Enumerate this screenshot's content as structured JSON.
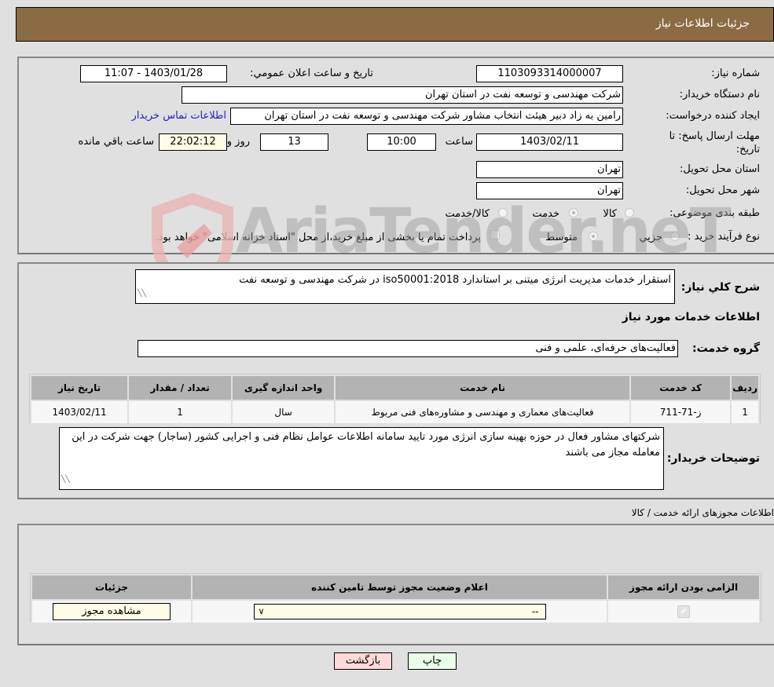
{
  "header": {
    "title": "جزئیات اطلاعات نیاز"
  },
  "details": {
    "need_number_label": "شماره نیاز:",
    "need_number": "1103093314000007",
    "announce_label": "تاریخ و ساعت اعلان عمومي:",
    "announce_value": "1403/01/28 - 11:07",
    "buyer_org_label": "نام دستگاه خریدار:",
    "buyer_org": "شرکت مهندسی و توسعه نفت در استان تهران",
    "requester_label": "ایجاد کننده درخواست:",
    "requester": "رامین به زاد دبیر هیئت انتخاب مشاور شرکت مهندسی و توسعه نفت در استان تهران",
    "buyer_contact_link": "اطلاعات تماس خریدار",
    "deadline_label": "مهلت ارسال پاسخ: تا تاریخ:",
    "deadline_date": "1403/02/11",
    "time_label": "ساعت",
    "deadline_time": "10:00",
    "days_value": "13",
    "days_label": "روز و",
    "remaining_time": "22:02:12",
    "remaining_label": "ساعت باقي مانده",
    "province_label": "استان محل تحویل:",
    "province": "تهران",
    "city_label": "شهر محل تحویل:",
    "city": "تهران",
    "category_label": "طبقه بندی موضوعی:",
    "category_options": [
      {
        "label": "کالا",
        "checked": false
      },
      {
        "label": "خدمت",
        "checked": true
      },
      {
        "label": "کالا/خدمت",
        "checked": false
      }
    ],
    "process_label": "نوع فرآیند خرید :",
    "process_options": [
      {
        "label": "جزيي",
        "checked": false
      },
      {
        "label": "متوسط",
        "checked": true
      }
    ],
    "treasury_note": "پرداخت تمام یا بخشی از مبلغ خرید،از محل \"اسناد خزانه اسلامی\" خواهد بود."
  },
  "need": {
    "summary_label": "شرح کلي نیاز:",
    "summary": "استقرار خدمات مدیریت انرژی میتنی بر استاندارد iso50001:2018 در شرکت مهندسی و توسعه نفت",
    "services_heading": "اطلاعات خدمات مورد نیاز",
    "service_group_label": "گروه خدمت:",
    "service_group": "فعالیت‌های حرفه‌ای، علمی و فنی",
    "table": {
      "headers": [
        "ردیف",
        "کد خدمت",
        "نام خدمت",
        "واحد اندازه گیری",
        "تعداد / مقدار",
        "تاریخ نیاز"
      ],
      "rows": [
        [
          "1",
          "ز-71-711",
          "فعالیت‌های معماری و مهندسی و مشاوره‌های فنی مربوط",
          "سال",
          "1",
          "1403/02/11"
        ]
      ]
    },
    "buyer_notes_label": "توضیحات خریدار:",
    "buyer_notes": "شرکتهای مشاور فعال در حوزه بهینه سازی انرژی مورد تایید سامانه اطلاعات عوامل نظام فنی و اجرایی کشور (ساجار) جهت شرکت در این معامله مجاز می باشند"
  },
  "permits": {
    "heading": "اطلاعات مجوزهای ارائه خدمت / کالا",
    "headers": [
      "الزامی بودن ارائه مجوز",
      "اعلام وضعیت مجوز توسط تامین کننده",
      "جزئیات"
    ],
    "rows": [
      {
        "required": true,
        "status_select": "--",
        "details_button": "مشاهده مجوز"
      }
    ]
  },
  "footer": {
    "print_button": "چاپ",
    "back_button": "بازگشت"
  },
  "watermark": {
    "text": "AriaTender.neT"
  },
  "colors": {
    "header_bg": "#8b6c42",
    "link": "#1c1cd6",
    "print_bg": "#eaffea",
    "back_bg": "#ffdada",
    "yellow_field": "#fffde8"
  }
}
